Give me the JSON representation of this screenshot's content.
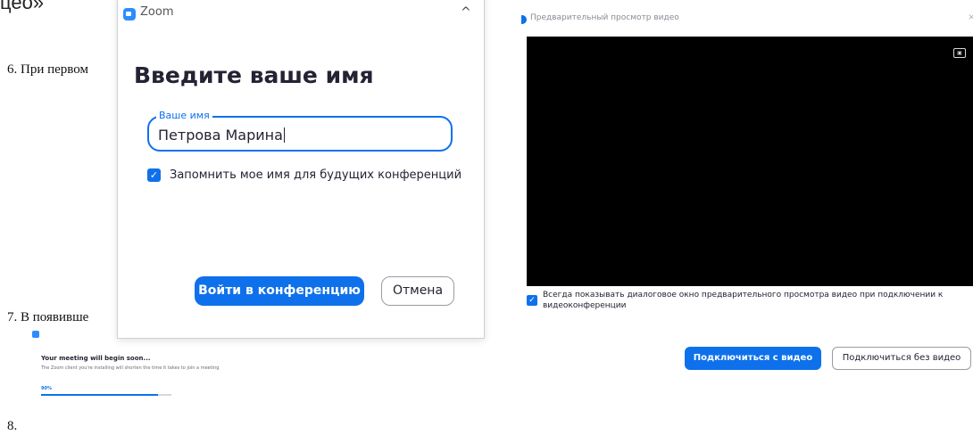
{
  "doc": {
    "heading_fragment": "цео»",
    "item6": "6. При первом",
    "item7": "7. В появивше",
    "item8": "8."
  },
  "zoom_dialog": {
    "app_title": "Zoom",
    "logo_icon": "zoom-logo-icon",
    "collapse_icon": "chevron-up-icon",
    "collapse_glyph": "^",
    "heading": "Введите ваше имя",
    "name_field": {
      "legend": "Ваше имя",
      "value": "Петрова Марина"
    },
    "remember_checkbox": {
      "checked": true,
      "label": "Запомнить мое имя для будущих конференций"
    },
    "join_button": "Войти в конференцию",
    "cancel_button": "Отмена",
    "accent_color": "#0e71eb"
  },
  "begin_dialog": {
    "title": "Your meeting will begin soon...",
    "description": "The Zoom client you're installing will shorten the time it takes to join a meeting",
    "progress_label": "90%",
    "progress": 0.9
  },
  "video_preview": {
    "title": "Предварительный просмотр видео",
    "close_glyph": "×",
    "camera_icon": "image-icon",
    "always_show_checkbox": {
      "checked": true,
      "label": "Всегда показывать диалоговое окно предварительного просмотра видео при подключении к видеоконференции"
    },
    "join_with_video": "Подключиться с видео",
    "join_without_video": "Подключиться без видео"
  }
}
